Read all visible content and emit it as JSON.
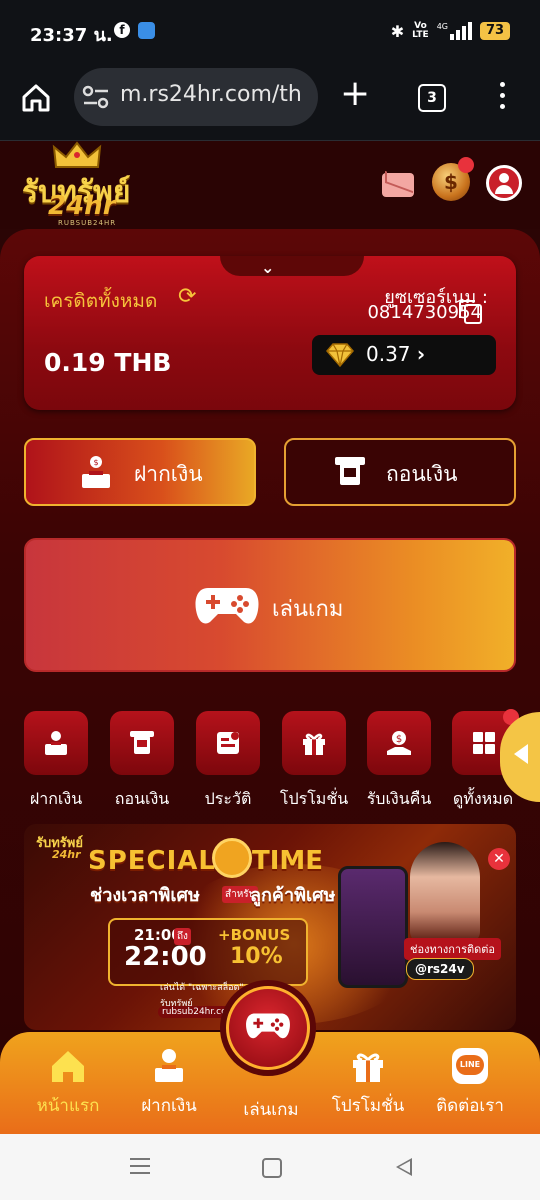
{
  "status_bar": {
    "time": "23:37 น.",
    "facebook_icon": "facebook-icon",
    "volte_line1": "Vo",
    "volte_line2": "LTE",
    "network": "4G",
    "battery": "73"
  },
  "browser": {
    "url": "m.rs24hr.com/th",
    "tab_count": "3"
  },
  "header": {
    "logo_main": "รับทรัพย์",
    "logo_sub": "24hr",
    "logo_tagline": "RUBSUB24HR",
    "icons": [
      "mail-icon",
      "coin-icon",
      "user-icon"
    ],
    "coin_symbol": "$"
  },
  "credit": {
    "title": "เครดิตทั้งหมด",
    "amount": "0.19 THB",
    "username_label": "ยูซเซอร์เนม :",
    "username": "0814730954",
    "diamond_value": "0.37",
    "diamond_arrow": "›"
  },
  "actions": {
    "deposit": "ฝากเงิน",
    "withdraw": "ถอนเงิน",
    "play": "เล่นเกม"
  },
  "quick_menu": [
    {
      "label": "ฝากเงิน",
      "icon": "deposit-icon"
    },
    {
      "label": "ถอนเงิน",
      "icon": "withdraw-icon"
    },
    {
      "label": "ประวัติ",
      "icon": "history-icon"
    },
    {
      "label": "โปรโมชั่น",
      "icon": "gift-icon"
    },
    {
      "label": "รับเงินคืน",
      "icon": "cashback-icon"
    },
    {
      "label": "ดูทั้งหมด",
      "icon": "grid-icon"
    }
  ],
  "banner": {
    "logo": "รับทรัพย์",
    "logo_sub": "24hr",
    "headline_1": "SPECIAL",
    "headline_2": "TIME",
    "thai_1": "ช่วงเวลาพิเศษ",
    "for_label": "สำหรับ",
    "thai_2": "ลูกค้าพิเศษ",
    "time_start": "21:00",
    "to_label": "ถึง",
    "time_end": "22:00",
    "bonus_label": "+BONUS",
    "bonus_pct": "10%",
    "note": "เล่นได้ \"เฉพาะสล็อต\"",
    "site_note": "รับทรัพย์",
    "website": "rubsub24hr.com",
    "contact_label": "ช่องทางการติดต่อ",
    "line_id": "@rs24v",
    "close": "✕"
  },
  "bottom_nav": {
    "home": "หน้าแรก",
    "deposit": "ฝากเงิน",
    "play": "เล่นเกม",
    "promotion": "โปรโมชั่น",
    "contact": "ติดต่อเรา",
    "line_badge": "LINE"
  },
  "colors": {
    "accent_gold": "#f6c33b",
    "card_red": "#c0101a",
    "nav_orange": "#f0a31d",
    "badge_red": "#e8323c"
  }
}
